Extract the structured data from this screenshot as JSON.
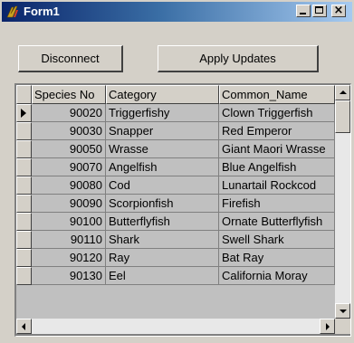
{
  "window": {
    "title": "Form1",
    "controls": {
      "minimize_icon": "minimize-icon",
      "maximize_icon": "maximize-icon",
      "close_icon": "close-icon",
      "close_glyph": "×"
    }
  },
  "toolbar": {
    "disconnect_label": "Disconnect",
    "apply_updates_label": "Apply Updates"
  },
  "grid": {
    "columns": [
      "Species No",
      "Category",
      "Common_Name"
    ],
    "current_row_index": 0,
    "rows": [
      [
        "90020",
        "Triggerfishy",
        "Clown Triggerfish"
      ],
      [
        "90030",
        "Snapper",
        "Red Emperor"
      ],
      [
        "90050",
        "Wrasse",
        "Giant Maori Wrasse"
      ],
      [
        "90070",
        "Angelfish",
        "Blue Angelfish"
      ],
      [
        "90080",
        "Cod",
        "Lunartail Rockcod"
      ],
      [
        "90090",
        "Scorpionfish",
        "Firefish"
      ],
      [
        "90100",
        "Butterflyfish",
        "Ornate Butterflyfish"
      ],
      [
        "90110",
        "Shark",
        "Swell Shark"
      ],
      [
        "90120",
        "Ray",
        "Bat Ray"
      ],
      [
        "90130",
        "Eel",
        "California Moray"
      ]
    ]
  },
  "colors": {
    "titlebar_start": "#0a246a",
    "titlebar_end": "#a6caf0",
    "face": "#d4d0c8",
    "grid_bg": "#c0c0c0"
  }
}
